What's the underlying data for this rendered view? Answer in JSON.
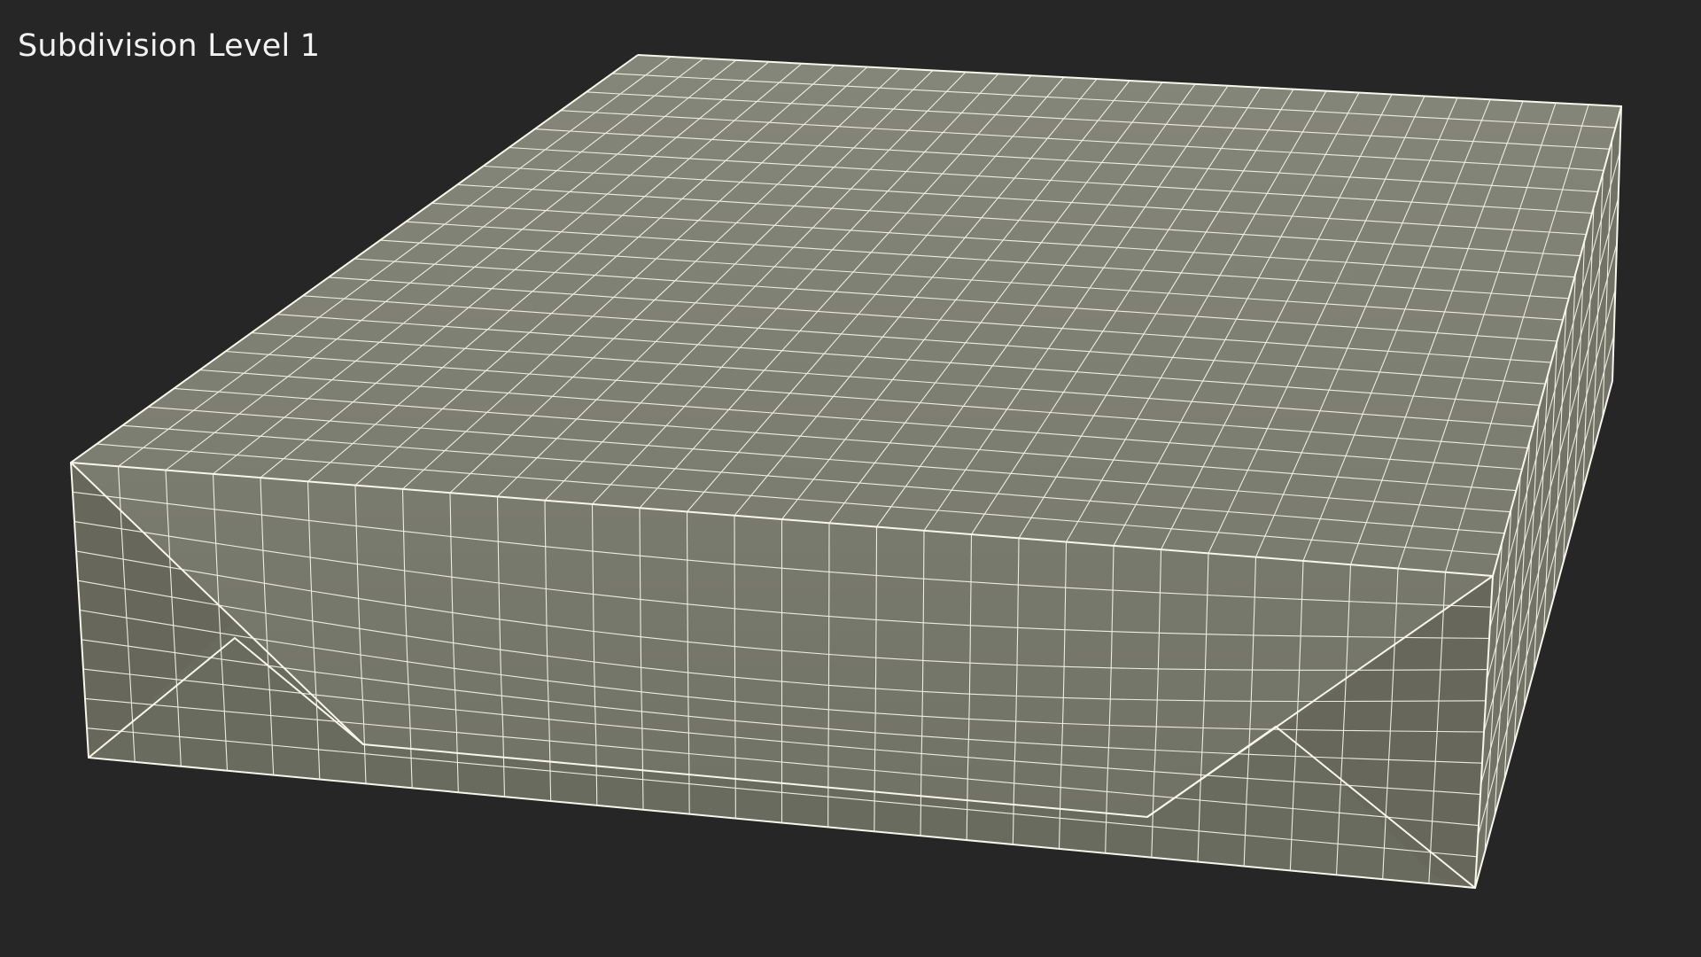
{
  "viewport": {
    "label": "Subdivision Level 1",
    "background_color": "#262626",
    "surface_color": "#7a7b6e",
    "wire_color": "#f4f4e6",
    "label_color": "#f2f2f2"
  }
}
